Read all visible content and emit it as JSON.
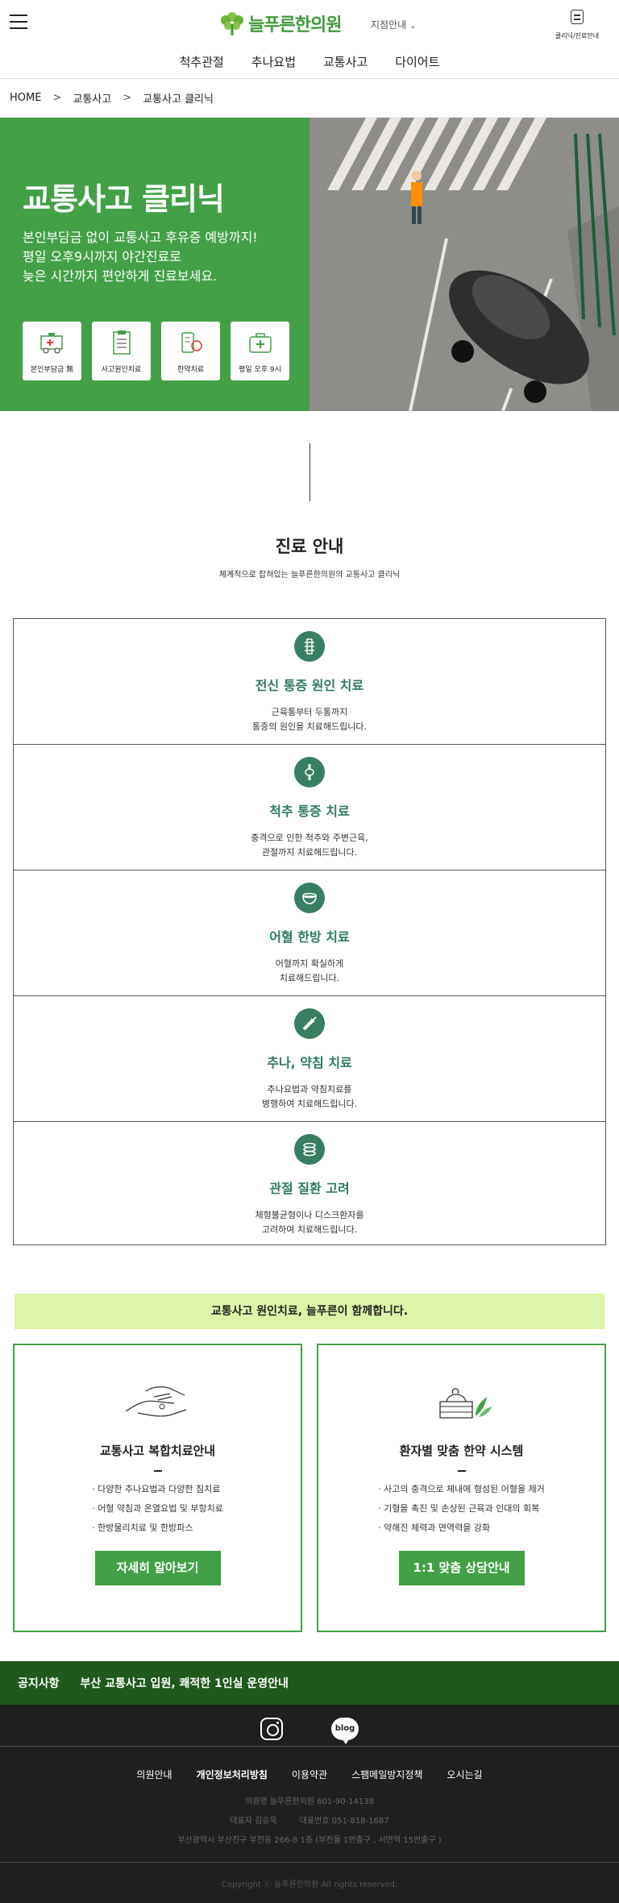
{
  "header": {
    "logo_text": "늘푸른한의원",
    "branch_label": "지점안내",
    "clinic_guide_label": "클리닉/진료안내",
    "nav": [
      "척추관절",
      "추나요법",
      "교통사고",
      "다이어트"
    ]
  },
  "breadcrumb": [
    "HOME",
    "교통사고",
    "교통사고 클리닉"
  ],
  "hero": {
    "title": "교통사고 클리닉",
    "desc_lines": [
      "본인부담금 없이 교통사고 후유증 예방까지!",
      "평일 오후9시까지 야간진료로",
      "늦은 시간까지 편안하게 진료보세요."
    ],
    "icons": [
      {
        "label": "본인부담금 無",
        "icon": "ambulance-icon"
      },
      {
        "label": "사고원인치료",
        "icon": "clipboard-icon"
      },
      {
        "label": "한약치료",
        "icon": "medicine-icon"
      },
      {
        "label": "평일 오후 9시",
        "icon": "medkit-icon"
      }
    ]
  },
  "section": {
    "title": "진료 안내",
    "subtitle": "체계적으로 잡혀있는 늘푸른한의원의 교통사고 클리닉"
  },
  "treatments": [
    {
      "name": "전신 통증 원인 치료",
      "desc": [
        "근육통부터 두통까지",
        "통증의 원인을 치료해드립니다."
      ],
      "icon": "spine-icon"
    },
    {
      "name": "척추 통증 치료",
      "desc": [
        "충격으로 인한 척추와 주변근육,",
        "관절까지 치료해드립니다."
      ],
      "icon": "joint-icon"
    },
    {
      "name": "어혈 한방 치료",
      "desc": [
        "어혈까지 확실하게",
        "치료해드립니다."
      ],
      "icon": "herbal-bowl-icon"
    },
    {
      "name": "추나, 약침 치료",
      "desc": [
        "추나요법과 약침치료를",
        "병행하여 치료해드립니다."
      ],
      "icon": "syringe-icon"
    },
    {
      "name": "관절 질환 고려",
      "desc": [
        "체형불균형이나 디스크환자를",
        "고려하여 치료해드립니다."
      ],
      "icon": "disc-icon"
    }
  ],
  "collab": {
    "banner": "교통사고 원인치료, 늘푸른이 함께합니다.",
    "cards": [
      {
        "title": "교통사고 복합치료안내",
        "items": [
          "· 다양한 추나요법과 다양한 침치료",
          "· 어혈 약침과 온열요법 및 부항치료",
          "· 한방물리치료 및 한방파스"
        ],
        "button": "자세히 알아보기",
        "icon": "hands-icon"
      },
      {
        "title": "환자별 맞춤 한약 시스템",
        "items": [
          "· 사고의 충격으로 체내에 형성된 어혈을 제거",
          "· 기혈을 촉진 및 손상된 근육과 인대의 회복",
          "· 약해진 체력과 면역력을 강화"
        ],
        "button": "1:1 맞춤 상담안내",
        "icon": "herb-package-icon"
      }
    ]
  },
  "notice": {
    "label": "공지사항",
    "text": "부산 교통사고 입원, 쾌적한 1인실 운영안내"
  },
  "footer": {
    "social": [
      "instagram-icon",
      "blog"
    ],
    "blog_label": "blog",
    "links": [
      "의원안내",
      "개인정보처리방침",
      "이용약관",
      "스팸메일방지정책",
      "오시는길"
    ],
    "info": {
      "line1": "의원명 늘푸른한의원 601-90-14138",
      "rep": "대표자 김승욱",
      "phone": "대표번호 051-818-1687",
      "address": "부산광역시 부산진구 부전동 266-8 1층 (부전몰 1번출구 , 서면역 15번출구 )"
    },
    "copyright": "Copyright ⓒ 늘푸른한의원 All rights reserved."
  },
  "colors": {
    "brand_green": "#43a047",
    "treat_teal": "#2f7a5d",
    "banner_lime": "#dcf5a8",
    "notice_green": "#20591b",
    "footer_dark": "#1f1f1f"
  }
}
